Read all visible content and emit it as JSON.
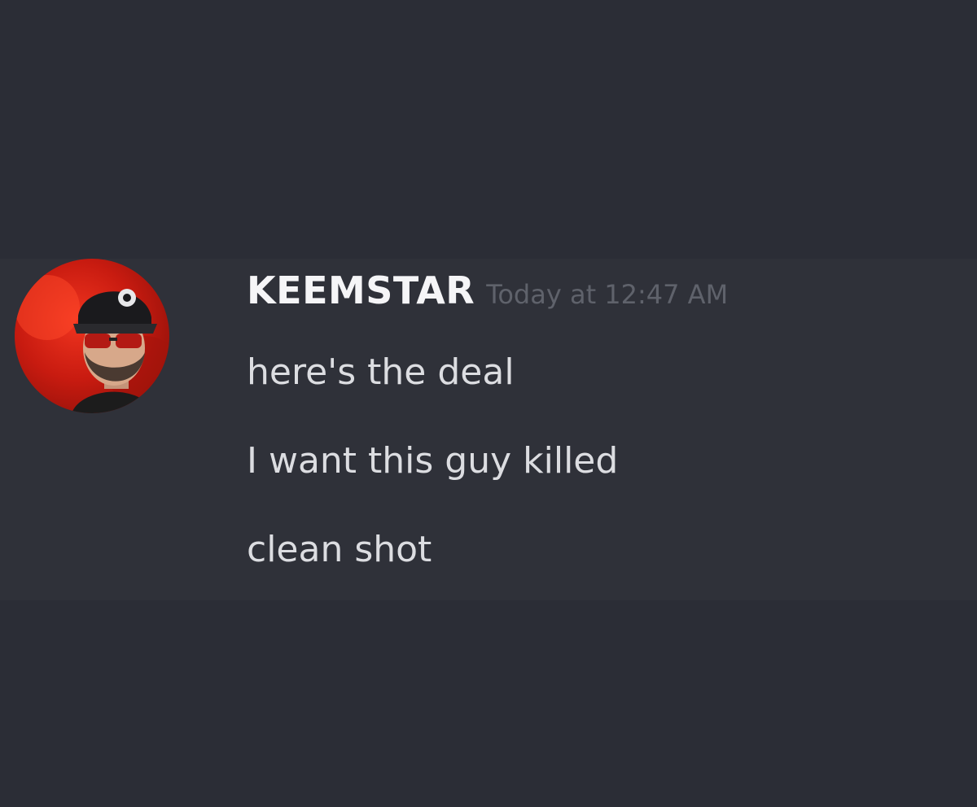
{
  "message": {
    "author": "KEEMSTAR",
    "timestamp": "Today at 12:47 AM",
    "lines": [
      "here's the deal",
      "I want this guy killed",
      "clean shot"
    ]
  },
  "colors": {
    "background": "#2b2d36",
    "message_background": "#2f3139",
    "username": "#f5f5f7",
    "timestamp": "#5f626b",
    "message_text": "#dcdde1",
    "avatar_red": "#d92313"
  },
  "icons": {
    "avatar": "user-avatar-photo"
  }
}
